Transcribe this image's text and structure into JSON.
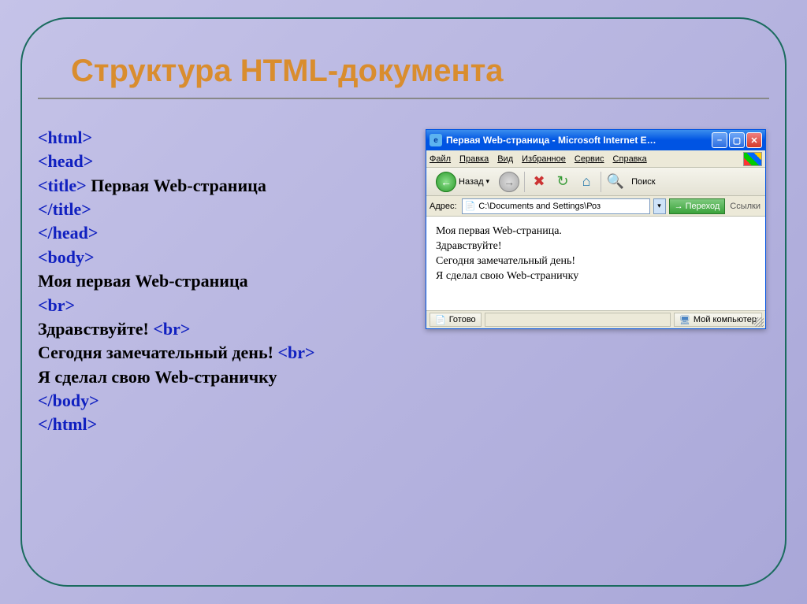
{
  "slide": {
    "title": "Структура HTML-документа"
  },
  "code": {
    "l1": "<html>",
    "l2": "<head>",
    "l3a": "<title>",
    "l3b": " Первая  Web-страница",
    "l4": "</title>",
    "l5": "</head>",
    "l6": "<body>",
    "l7": "Моя первая Web-страница",
    "l8": "<br>",
    "l9a": "Здравствуйте! ",
    "l9b": "<br>",
    "l10a": "Сегодня замечательный день! ",
    "l10b": "<br>",
    "l11": "Я сделал свою Web-страничку",
    "l12": "</body>",
    "l13": "</html>"
  },
  "browser": {
    "title": "Первая Web-страница - Microsoft Internet E…",
    "menu": {
      "file": "Файл",
      "edit": "Правка",
      "view": "Вид",
      "fav": "Избранное",
      "tools": "Сервис",
      "help": "Справка"
    },
    "toolbar": {
      "back": "Назад",
      "search": "Поиск"
    },
    "address": {
      "label": "Адрес:",
      "value": "C:\\Documents and Settings\\Роз",
      "go": "Переход",
      "links": "Ссылки"
    },
    "page": {
      "l1": "Моя первая Web-страница.",
      "l2": "Здравствуйте!",
      "l3": "Сегодня замечательный день!",
      "l4": "Я сделал свою Web-страничку"
    },
    "status": {
      "done": "Готово",
      "zone": "Мой компьютер"
    }
  }
}
